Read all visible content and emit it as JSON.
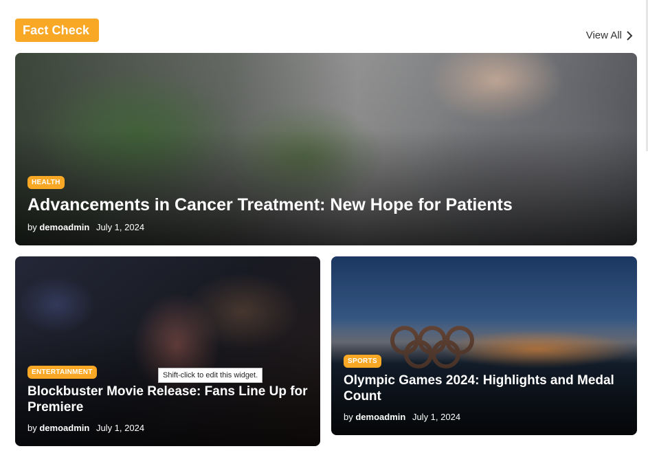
{
  "section": {
    "title": "Fact Check",
    "view_all": "View All"
  },
  "cards": [
    {
      "category": "HEALTH",
      "title": "Advancements in Cancer Treatment: New Hope for Patients",
      "by": "by",
      "author": "demoadmin",
      "date": "July 1, 2024"
    },
    {
      "category": "ENTERTAINMENT",
      "title": "Blockbuster Movie Release: Fans Line Up for Premiere",
      "by": "by",
      "author": "demoadmin",
      "date": "July 1, 2024"
    },
    {
      "category": "SPORTS",
      "title": "Olympic Games 2024: Highlights and Medal Count",
      "by": "by",
      "author": "demoadmin",
      "date": "July 1, 2024"
    }
  ],
  "tooltip": "Shift-click to edit this widget.",
  "colors": {
    "accent": "#f9a825",
    "text_dark": "#333333"
  },
  "icons": {
    "view_all": "chevron-right-icon"
  }
}
